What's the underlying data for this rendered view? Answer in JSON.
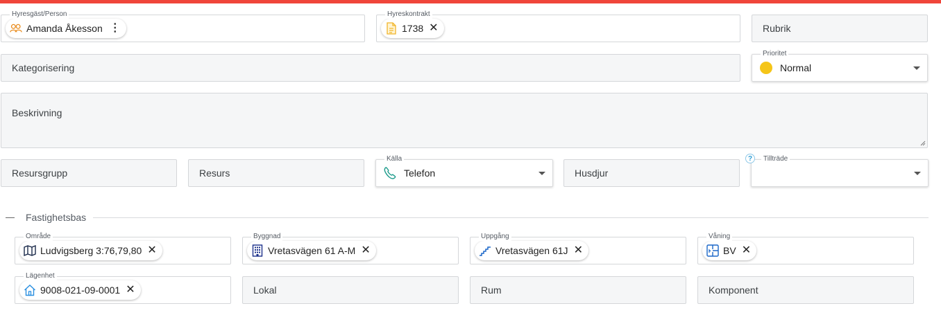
{
  "row1": {
    "tenant": {
      "label": "Hyresgäst/Person",
      "value": "Amanda Åkesson",
      "icon": "people-icon",
      "menu": "⋮"
    },
    "contract": {
      "label": "Hyreskontrakt",
      "value": "1738",
      "icon": "document-icon",
      "remove": "✕"
    },
    "title": {
      "placeholder": "Rubrik"
    }
  },
  "row2": {
    "category": {
      "placeholder": "Kategorisering"
    },
    "priority": {
      "label": "Prioritet",
      "value": "Normal",
      "dot_color": "#f5c518"
    }
  },
  "description": {
    "placeholder": "Beskrivning"
  },
  "row4": {
    "resource_group": {
      "placeholder": "Resursgrupp"
    },
    "resource": {
      "placeholder": "Resurs"
    },
    "source": {
      "label": "Källa",
      "value": "Telefon",
      "icon": "phone-icon"
    },
    "pets": {
      "placeholder": "Husdjur"
    },
    "access": {
      "label": "Tillträde",
      "value": "",
      "help": "?"
    }
  },
  "section": {
    "title": "Fastighetsbas"
  },
  "property": {
    "area": {
      "label": "Område",
      "value": "Ludvigsberg 3:76,79,80",
      "icon": "map-icon",
      "remove": "✕"
    },
    "building": {
      "label": "Byggnad",
      "value": "Vretasvägen 61 A-M",
      "icon": "building-icon",
      "remove": "✕"
    },
    "entrance": {
      "label": "Uppgång",
      "value": "Vretasvägen 61J",
      "icon": "stairs-icon",
      "remove": "✕"
    },
    "floor": {
      "label": "Våning",
      "value": "BV",
      "icon": "floor-icon",
      "remove": "✕"
    },
    "apartment": {
      "label": "Lägenhet",
      "value": "9008-021-09-0001",
      "icon": "home-icon",
      "remove": "✕"
    },
    "premises": {
      "placeholder": "Lokal"
    },
    "room": {
      "placeholder": "Rum"
    },
    "component": {
      "placeholder": "Komponent"
    }
  },
  "colors": {
    "accent_bar": "#f0453a",
    "chip_icon_orange": "#e98b1c",
    "chip_icon_blue": "#1a66c8",
    "phone_icon": "#1a9a8a"
  }
}
